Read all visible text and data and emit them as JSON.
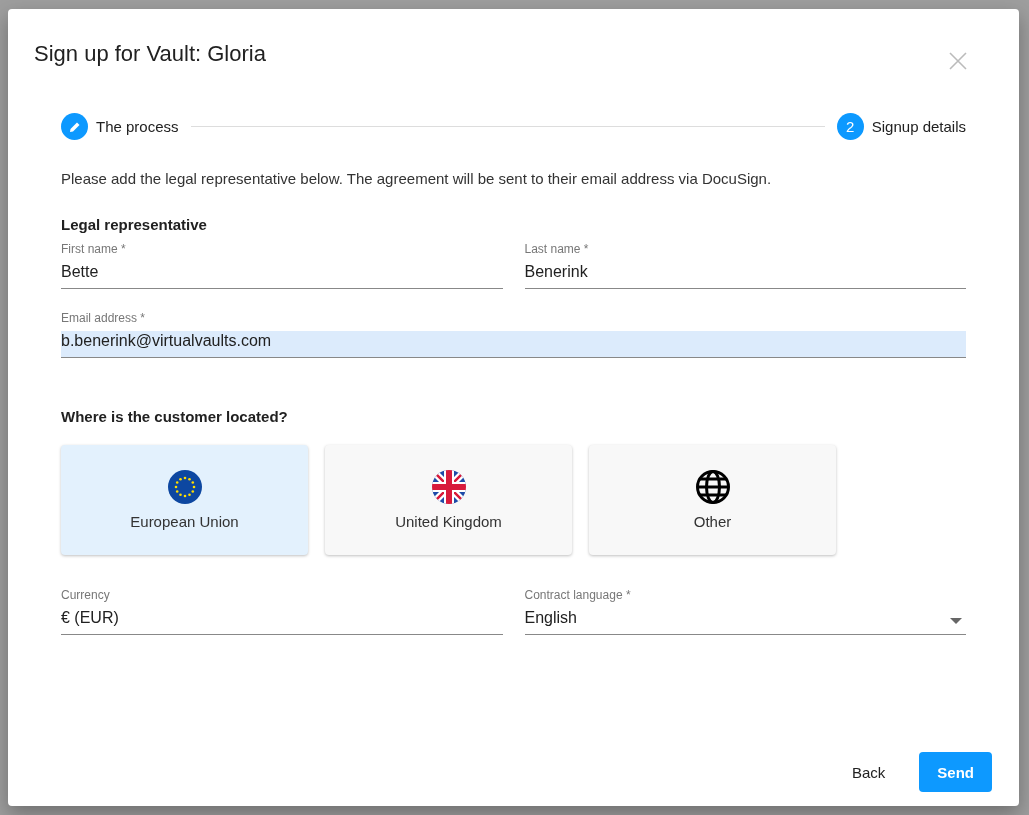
{
  "dialog": {
    "title": "Sign up for Vault: Gloria"
  },
  "steps": [
    {
      "kind": "edit",
      "label": "The process"
    },
    {
      "kind": "number",
      "number": "2",
      "label": "Signup details"
    }
  ],
  "intro": "Please add the legal representative below. The agreement will be sent to their email address via DocuSign.",
  "section_title": "Legal representative",
  "name_fields": [
    {
      "label": "First name *",
      "value": "Bette"
    },
    {
      "label": "Last name *",
      "value": "Benerink"
    }
  ],
  "email_field": {
    "label": "Email address *",
    "value": "b.benerink@virtualvaults.com",
    "highlighted": true
  },
  "location_title": "Where is the customer located?",
  "locations": [
    {
      "kind": "eu",
      "label": "European Union",
      "selected": true
    },
    {
      "kind": "uk",
      "label": "United Kingdom",
      "selected": false
    },
    {
      "kind": "globe",
      "label": "Other",
      "selected": false
    }
  ],
  "currency_field": {
    "label": "Currency",
    "value": "€ (EUR)"
  },
  "language_field": {
    "label": "Contract language *",
    "value": "English"
  },
  "buttons": [
    {
      "kind": "text",
      "label": "Back"
    },
    {
      "kind": "primary",
      "label": "Send"
    }
  ]
}
